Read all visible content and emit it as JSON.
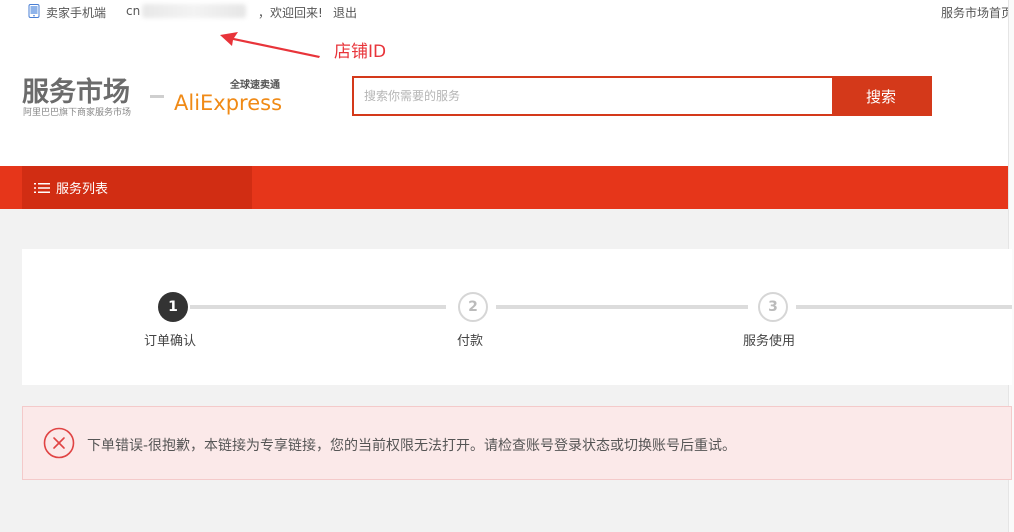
{
  "topbar": {
    "phone_label": "卖家手机端",
    "user_prefix": "cn",
    "welcome": "，欢迎回来!",
    "logout": "退出",
    "home_link": "服务市场首页"
  },
  "annotation": {
    "label": "店铺ID",
    "color": "#e8343a"
  },
  "header": {
    "logo_market_title": "服务市场",
    "logo_market_subtitle": "阿里巴巴旗下商家服务市场",
    "logo_ae_brand": "AliExpress",
    "logo_ae_slogan": "全球速卖通",
    "search_placeholder": "搜索你需要的服务",
    "search_button": "搜索",
    "brand_color": "#d4391a"
  },
  "nav": {
    "service_list": "服务列表",
    "icon": "list-icon"
  },
  "steps": [
    {
      "number": "1",
      "label": "订单确认",
      "state": "active"
    },
    {
      "number": "2",
      "label": "付款",
      "state": "inactive"
    },
    {
      "number": "3",
      "label": "服务使用",
      "state": "inactive"
    }
  ],
  "error": {
    "message": "下单错误-很抱歉，本链接为专享链接，您的当前权限无法打开。请检查账号登录状态或切换账号后重试。",
    "icon": "error-circle-x-icon",
    "color": "#e04444"
  }
}
